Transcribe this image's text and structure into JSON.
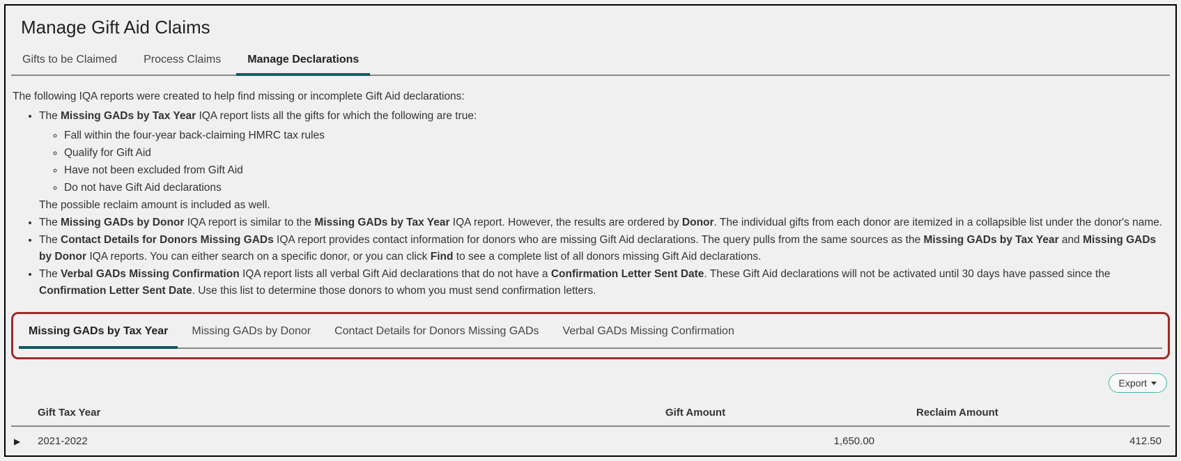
{
  "page_title": "Manage Gift Aid Claims",
  "top_tabs": [
    {
      "label": "Gifts to be Claimed",
      "active": false
    },
    {
      "label": "Process Claims",
      "active": false
    },
    {
      "label": "Manage Declarations",
      "active": true
    }
  ],
  "intro": {
    "lead": "The following IQA reports were created to help find missing or incomplete Gift Aid declarations:",
    "b1_pre": "The ",
    "b1_bold": "Missing GADs by Tax Year",
    "b1_post": " IQA report lists all the gifts for which the following are true:",
    "b1_sub1": "Fall within the four-year back-claiming HMRC tax rules",
    "b1_sub2": "Qualify for Gift Aid",
    "b1_sub3": "Have not been excluded from Gift Aid",
    "b1_sub4": "Do not have Gift Aid declarations",
    "b1_tail": "The possible reclaim amount is included as well.",
    "b2_pre": "The ",
    "b2_bold1": "Missing GADs by Donor",
    "b2_mid1": " IQA report is similar to the ",
    "b2_bold2": "Missing GADs by Tax Year",
    "b2_mid2": " IQA report. However, the results are ordered by ",
    "b2_bold3": "Donor",
    "b2_post": ". The individual gifts from each donor are itemized in a collapsible list under the donor's name.",
    "b3_pre": "The ",
    "b3_bold1": "Contact Details for Donors Missing GADs",
    "b3_mid1": " IQA report provides contact information for donors who are missing Gift Aid declarations. The query pulls from the same sources as the ",
    "b3_bold2": "Missing GADs by Tax Year",
    "b3_mid2": " and ",
    "b3_bold3": "Missing GADs by Donor",
    "b3_mid3": " IQA reports. You can either search on a specific donor, or you can click ",
    "b3_bold4": "Find",
    "b3_post": " to see a complete list of all donors missing Gift Aid declarations.",
    "b4_pre": "The ",
    "b4_bold1": "Verbal GADs Missing Confirmation",
    "b4_mid1": " IQA report lists all verbal Gift Aid declarations that do not have a ",
    "b4_bold2": "Confirmation Letter Sent Date",
    "b4_mid2": ". These Gift Aid declarations will not be activated until 30 days have passed since the ",
    "b4_bold3": "Confirmation Letter Sent Date",
    "b4_post": ". Use this list to determine those donors to whom you must send confirmation letters."
  },
  "sub_tabs": [
    {
      "label": "Missing GADs by Tax Year",
      "active": true
    },
    {
      "label": "Missing GADs by Donor",
      "active": false
    },
    {
      "label": "Contact Details for Donors Missing GADs",
      "active": false
    },
    {
      "label": "Verbal GADs Missing Confirmation",
      "active": false
    }
  ],
  "export_label": "Export",
  "table": {
    "headers": {
      "year": "Gift Tax Year",
      "amount": "Gift Amount",
      "reclaim": "Reclaim Amount"
    },
    "rows": [
      {
        "year": "2021-2022",
        "amount": "1,650.00",
        "reclaim": "412.50"
      }
    ]
  }
}
